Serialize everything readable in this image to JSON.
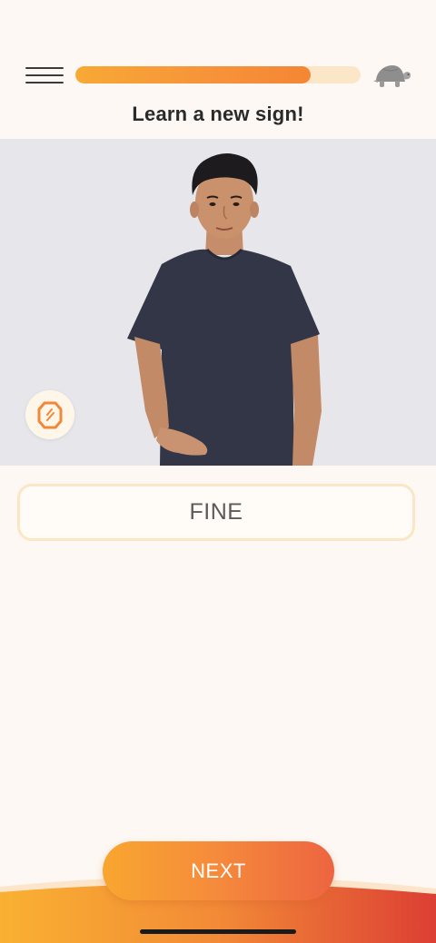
{
  "header": {
    "title": "Learn a new sign!",
    "progress_fraction": 0.825,
    "menu_icon": "hamburger-menu-icon",
    "speed_icon": "turtle-icon"
  },
  "video": {
    "mirror_icon": "mirror-icon"
  },
  "answer": {
    "word": "FINE"
  },
  "footer": {
    "next_label": "NEXT"
  },
  "colors": {
    "background": "#fdf8f3",
    "accent_orange": "#f7923a",
    "accent_red": "#e04535",
    "progress_track": "#fbe7c8"
  }
}
